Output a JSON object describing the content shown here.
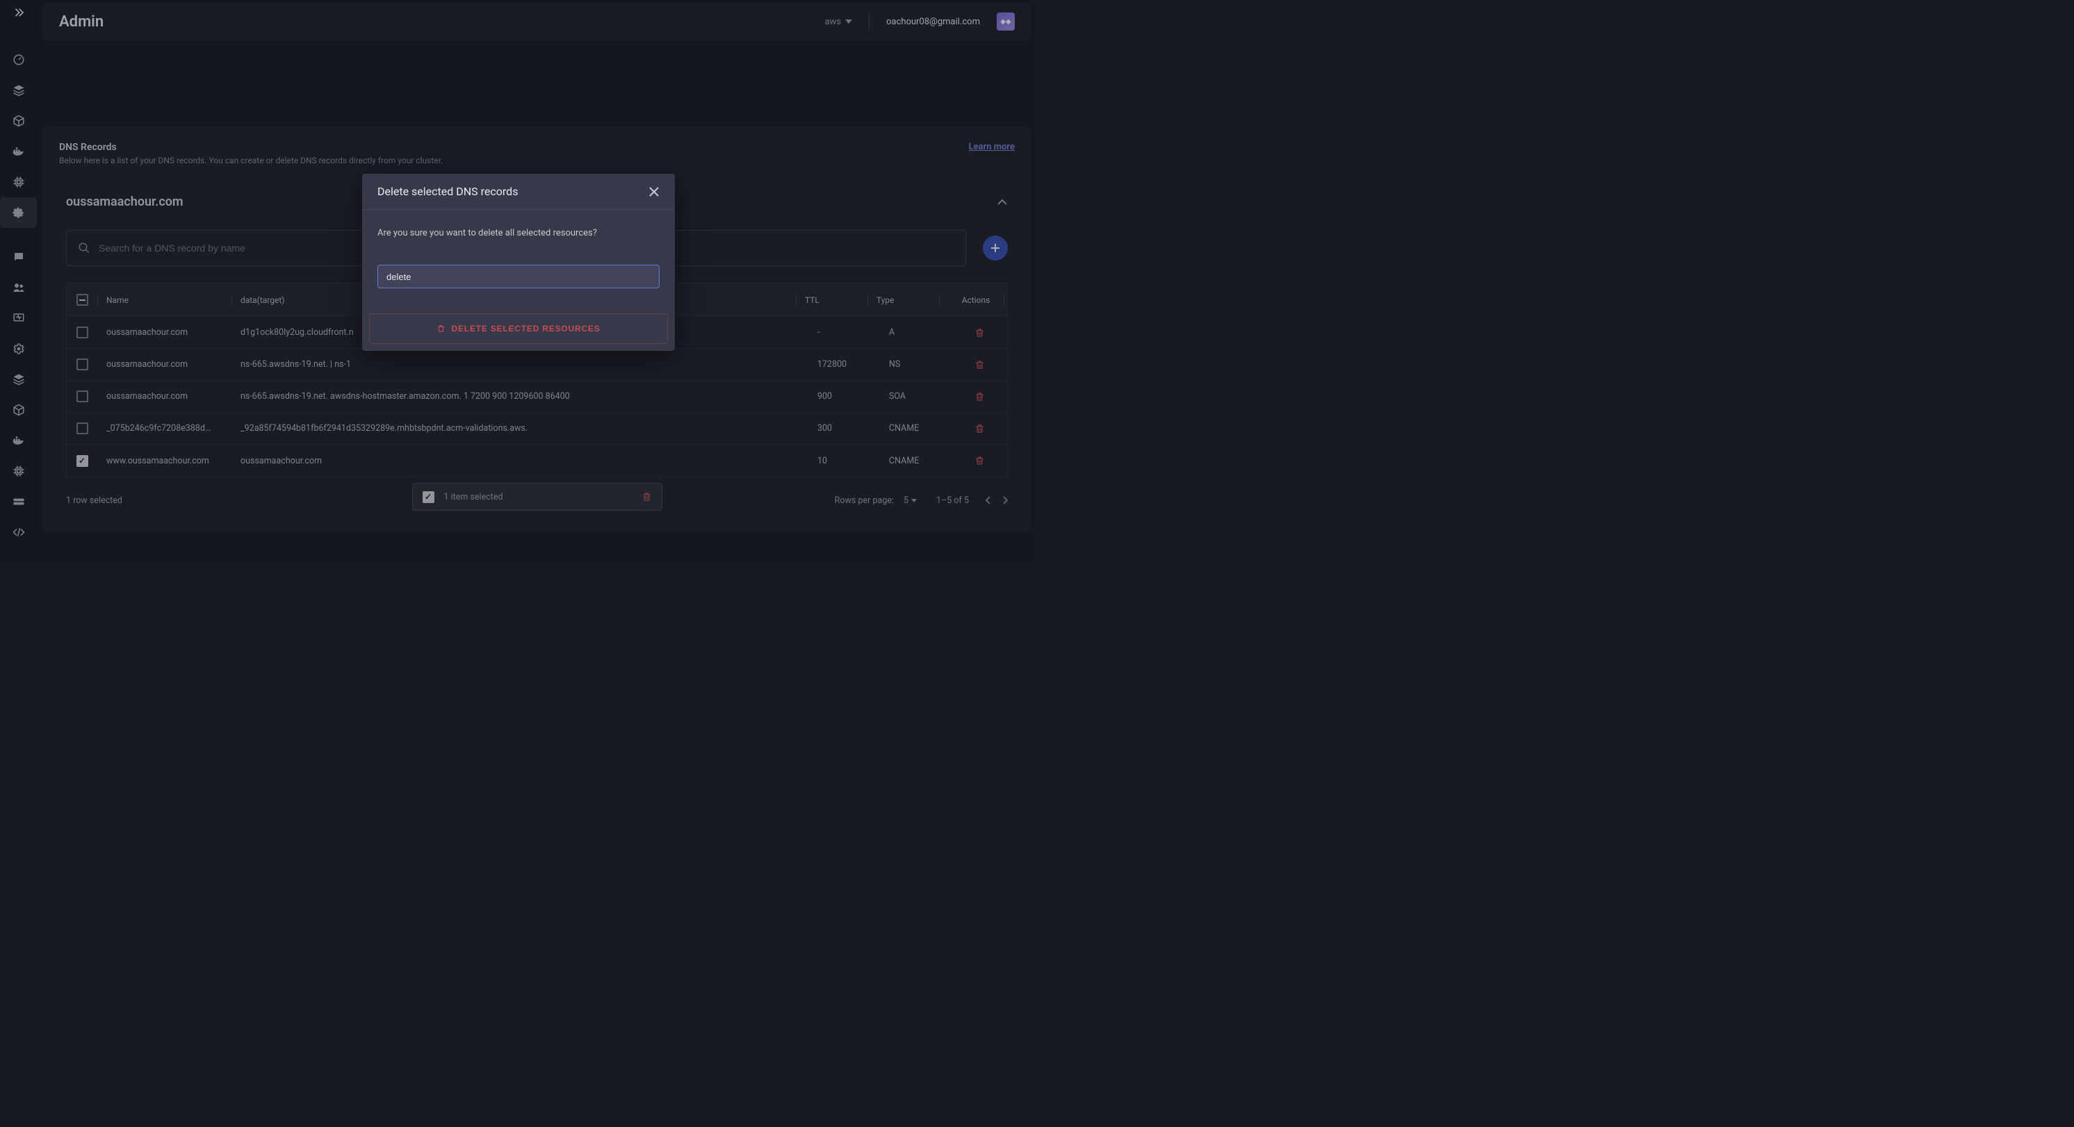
{
  "header": {
    "title": "Admin",
    "cloud_label": "aws",
    "user_email": "oachour08@gmail.com"
  },
  "section": {
    "title": "DNS Records",
    "subtitle": "Below here is a list of your DNS records. You can create or delete DNS records directly from your cluster.",
    "learn_more": "Learn more"
  },
  "domain": {
    "name": "oussamaachour.com",
    "search_placeholder": "Search for a DNS record by name"
  },
  "table": {
    "columns": {
      "name": "Name",
      "data": "data(target)",
      "ttl": "TTL",
      "type": "Type",
      "actions": "Actions"
    },
    "rows": [
      {
        "checked": false,
        "name": "oussamaachour.com",
        "data": "d1g1ock80ly2ug.cloudfront.n",
        "ttl": "-",
        "type": "A"
      },
      {
        "checked": false,
        "name": "oussamaachour.com",
        "data": "ns-665.awsdns-19.net. | ns-1",
        "ttl": "172800",
        "type": "NS"
      },
      {
        "checked": false,
        "name": "oussamaachour.com",
        "data": "ns-665.awsdns-19.net. awsdns-hostmaster.amazon.com. 1 7200 900 1209600 86400",
        "ttl": "900",
        "type": "SOA"
      },
      {
        "checked": false,
        "name": "_075b246c9fc7208e388d…",
        "data": "_92a85f74594b81fb6f2941d35329289e.mhbtsbpdnt.acm-validations.aws.",
        "ttl": "300",
        "type": "CNAME"
      },
      {
        "checked": true,
        "name": "www.oussamaachour.com",
        "data": "oussamaachour.com",
        "ttl": "10",
        "type": "CNAME"
      }
    ],
    "footer": {
      "selected_text": "1 row selected",
      "rows_per_label": "Rows per page:",
      "rows_per_value": "5",
      "range": "1–5 of 5"
    },
    "toast": {
      "text": "1 item selected"
    }
  },
  "modal": {
    "title": "Delete selected DNS records",
    "body": "Are you sure you want to delete all selected resources?",
    "input_value": "delete",
    "button": "DELETE SELECTED RESOURCES"
  }
}
